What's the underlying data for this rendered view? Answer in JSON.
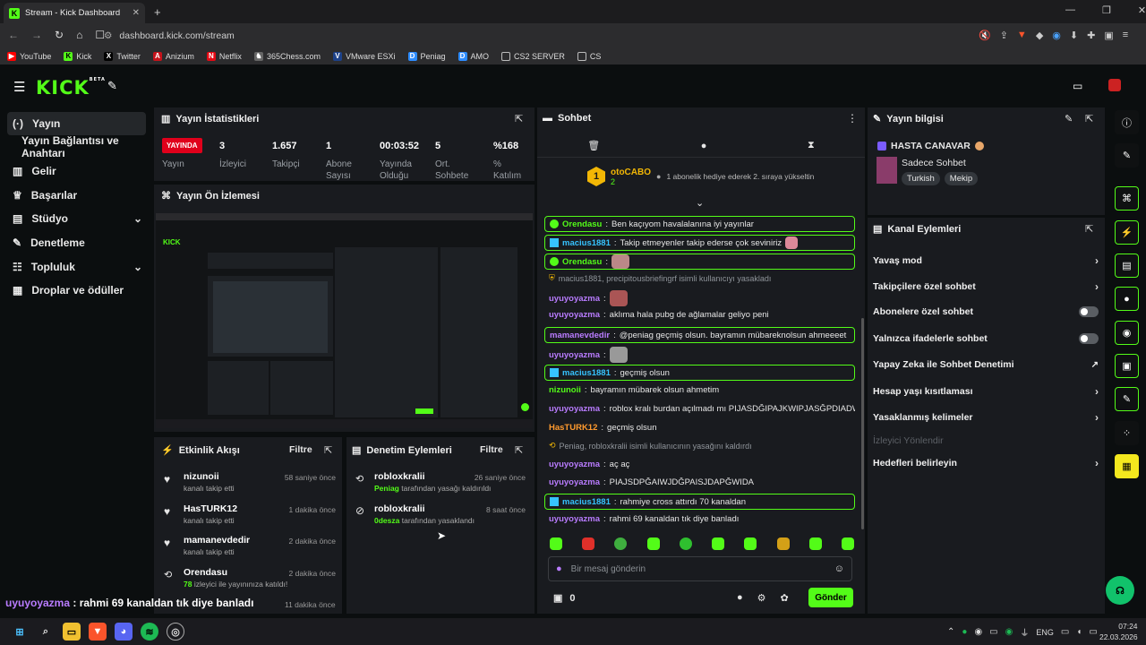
{
  "browser": {
    "tab_title": "Stream - Kick Dashboard",
    "url": "dashboard.kick.com/stream",
    "bookmarks": [
      "YouTube",
      "Kick",
      "Twitter",
      "Anizium",
      "Netflix",
      "365Chess.com",
      "VMware ESXi",
      "Peniag",
      "AMO",
      "CS2 SERVER",
      "CS"
    ]
  },
  "brand": {
    "logo": "KICK",
    "beta": "BETA"
  },
  "sidebar": {
    "items": [
      {
        "label": "Yayın",
        "icon": "broadcast-icon"
      },
      {
        "label": "Yayın Bağlantısı ve Anahtarı"
      },
      {
        "label": "Gelir",
        "icon": "chart-icon"
      },
      {
        "label": "Başarılar",
        "icon": "trophy-icon"
      },
      {
        "label": "Stüdyo",
        "icon": "studio-icon"
      },
      {
        "label": "Denetleme",
        "icon": "wrench-icon"
      },
      {
        "label": "Topluluk",
        "icon": "community-icon"
      },
      {
        "label": "Droplar ve ödüller",
        "icon": "gift-icon"
      }
    ]
  },
  "stats": {
    "title": "Yayın İstatistikleri",
    "live_badge": "YAYINDA",
    "live_label": "Yayın",
    "cols": [
      {
        "value": "3",
        "label": "İzleyici"
      },
      {
        "value": "1.657",
        "label": "Takipçi"
      },
      {
        "value": "1",
        "label": "Abone Sayısı"
      },
      {
        "value": "00:03:52",
        "label": "Yayında Olduğu"
      },
      {
        "value": "5",
        "label": "Ort. Sohbete"
      },
      {
        "value": "%168",
        "label": "% Katılım"
      }
    ]
  },
  "preview": {
    "title": "Yayın Ön İzlemesi"
  },
  "activity": {
    "title": "Etkinlik Akışı",
    "filter": "Filtre",
    "items": [
      {
        "name": "nizunoii",
        "sub": "kanalı takip etti",
        "time": "58 saniye önce"
      },
      {
        "name": "HasTURK12",
        "sub": "kanalı takip etti",
        "time": "1 dakika önce"
      },
      {
        "name": "mamanevdedir",
        "sub": "kanalı takip etti",
        "time": "2 dakika önce"
      },
      {
        "name": "Orendasu",
        "sub_count": "78",
        "sub": "izleyici ile yayınınıza katıldı!",
        "time": "2 dakika önce"
      },
      {
        "time": "11 dakika önce"
      }
    ]
  },
  "modlog": {
    "title": "Denetim Eylemleri",
    "filter": "Filtre",
    "items": [
      {
        "name": "robloxkralii",
        "actor": "Peniag",
        "sub": "tarafından yasağı kaldırıldı",
        "time": "26 saniye önce"
      },
      {
        "name": "robloxkralii",
        "actor": "0desza",
        "sub": "tarafından yasaklandı",
        "time": "8 saat önce"
      }
    ]
  },
  "chat": {
    "title": "Sohbet",
    "pinned_user": "otoCABO",
    "pinned_rank": "1",
    "pinned_count": "2",
    "pinned_text": "1 abonelik hediye ederek 2. sıraya yükseltin",
    "messages": [
      {
        "user": "Orendasu",
        "text": "Ben kaçıyom havalalanına iyi yayınlar",
        "color": "#53fc18",
        "hl": true
      },
      {
        "user": "macius1881",
        "text": "Takip etmeyenler takip ederse çok seviniriz",
        "color": "#36c3ff",
        "hl": true
      },
      {
        "user": "Orendasu",
        "text": "",
        "color": "#53fc18",
        "hl": true
      },
      {
        "system": "macius1881, precipitousbriefingrf isimli kullanıcıyı yasakladı"
      },
      {
        "user": "uyuyoyazma",
        "text": "",
        "color": "#b97cff"
      },
      {
        "user": "uyuyoyazma",
        "text": "aklıma hala pubg de ağlamalar geliyo peni",
        "color": "#b97cff"
      },
      {
        "user": "mamanevdedir",
        "text": "@peniag geçmiş olsun. bayramın mübareknolsun ahmeeeet",
        "color": "#b97cff",
        "hl": true,
        "mention": "@peniag"
      },
      {
        "user": "uyuyoyazma",
        "text": "",
        "color": "#b97cff"
      },
      {
        "user": "macius1881",
        "text": "geçmiş olsun",
        "color": "#36c3ff",
        "hl": true
      },
      {
        "user": "nizunoii",
        "text": "bayramın mübarek olsun ahmetim",
        "color": "#53fc18"
      },
      {
        "user": "uyuyoyazma",
        "text": "roblox kralı burdan açılmadı mı PIJASDĞIPAJKWIPJASĞPDIADW",
        "color": "#b97cff"
      },
      {
        "user": "HasTURK12",
        "text": "geçmiş olsun",
        "color": "#ff9a2e"
      },
      {
        "system": "Peniag, robloxkralii isimli kullanıcının yasağını kaldırdı"
      },
      {
        "user": "uyuyoyazma",
        "text": "aç aç",
        "color": "#b97cff"
      },
      {
        "user": "uyuyoyazma",
        "text": "PIAJSDPĞAIWJDĞPAISJDAPĞWIDA",
        "color": "#b97cff"
      },
      {
        "user": "macius1881",
        "text": "rahmiye cross attırdı 70 kanaldan",
        "color": "#36c3ff",
        "hl": true
      },
      {
        "user": "uyuyoyazma",
        "text": "rahmi 69 kanaldan tık diye banladı",
        "color": "#b97cff"
      }
    ],
    "input_placeholder": "Bir mesaj gönderin",
    "points": "0",
    "send": "Gönder"
  },
  "info": {
    "title": "Yayın bilgisi",
    "stream_title": "HASTA CANAVAR",
    "category": "Sadece Sohbet",
    "tags": [
      "Turkish",
      "Mekip"
    ]
  },
  "channel": {
    "title": "Kanal Eylemleri",
    "options": [
      {
        "label": "Yavaş mod",
        "kind": "arrow"
      },
      {
        "label": "Takipçilere özel sohbet",
        "kind": "arrow"
      },
      {
        "label": "Abonelere özel sohbet",
        "kind": "toggle"
      },
      {
        "label": "Yalnızca ifadelerle sohbet",
        "kind": "toggle"
      },
      {
        "label": "Yapay Zeka ile Sohbet Denetimi",
        "kind": "ext"
      },
      {
        "label": "Hesap yaşı kısıtlaması",
        "kind": "arrow"
      },
      {
        "label": "Yasaklanmış kelimeler",
        "kind": "arrow"
      },
      {
        "label": "İzleyici Yönlendir",
        "kind": "disabled"
      },
      {
        "label": "Hedefleri belirleyin",
        "kind": "arrow"
      }
    ]
  },
  "overlay": {
    "user": "uyuyoyazma",
    "text": " : rahmi 69 kanaldan tık diye banladı"
  },
  "taskbar": {
    "lang": "ENG",
    "time": "07:24",
    "date": "22.03.2026"
  }
}
